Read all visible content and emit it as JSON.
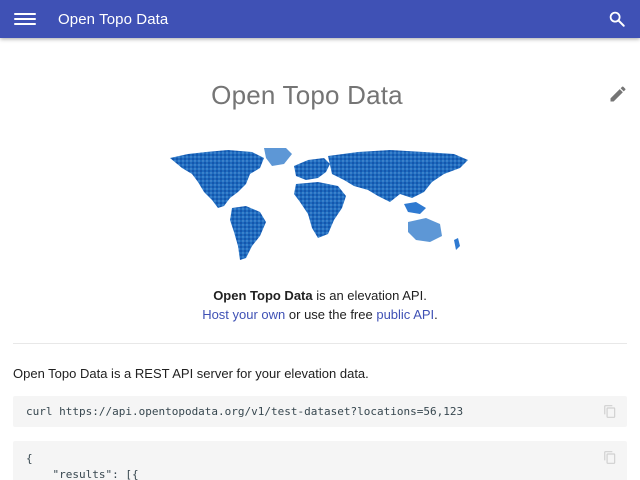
{
  "header": {
    "site_title": "Open Topo Data",
    "bar_color": "#3f51b5",
    "menu_icon": "menu-icon",
    "search_icon": "search-icon"
  },
  "page": {
    "title": "Open Topo Data",
    "edit_icon": "pencil-icon",
    "map_image": "world elevation map"
  },
  "intro": {
    "line1_bold": "Open Topo Data",
    "line1_rest": " is an elevation API.",
    "host_link": "Host your own",
    "middle": " or use the free ",
    "public_link": "public API",
    "end": "."
  },
  "body": {
    "description": "Open Topo Data is a REST API server for your elevation data."
  },
  "code": {
    "curl": "curl https://api.opentopodata.org/v1/test-dataset?locations=56,123",
    "json_line1": "{",
    "json_line2": "    \"results\": [{",
    "copy_icon": "copy-icon"
  },
  "colors": {
    "accent": "#3f51b5",
    "code_bg": "#f5f5f5",
    "map_blue": "#1565c0"
  }
}
